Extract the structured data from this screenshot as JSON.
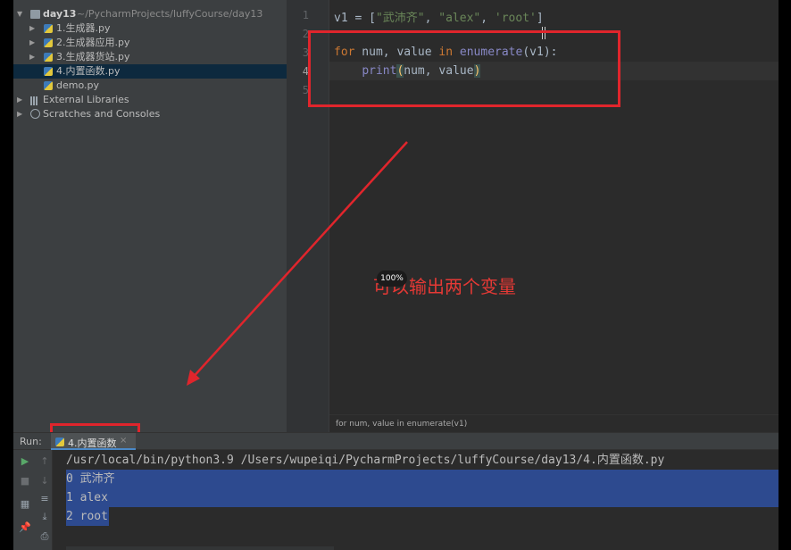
{
  "project": {
    "root": {
      "name": "day13",
      "path": "~/PycharmProjects/luffyCourse/day13"
    },
    "files": [
      {
        "label": "1.生成器.py",
        "selected": false
      },
      {
        "label": "2.生成器应用.py",
        "selected": false
      },
      {
        "label": "3.生成器货站.py",
        "selected": false
      },
      {
        "label": "4.内置函数.py",
        "selected": true
      },
      {
        "label": "demo.py",
        "selected": false
      }
    ],
    "external_libraries": "External Libraries",
    "scratches": "Scratches and Consoles"
  },
  "editor": {
    "line_numbers": [
      "1",
      "2",
      "3",
      "4",
      "5"
    ],
    "current_line": "4",
    "line1": {
      "var": "v1",
      "op": " = [",
      "s1": "\"武沛齐\"",
      "c1": ", ",
      "s2": "\"alex\"",
      "c2": ", ",
      "s3": "'root'",
      "end": "]"
    },
    "line3": {
      "kw_for": "for",
      "mid1": " num, value ",
      "kw_in": "in",
      "sp": " ",
      "fn": "enumerate",
      "args": "(v1):"
    },
    "line4": {
      "indent": "    ",
      "fn": "print",
      "lp": "(",
      "a1": "num, value",
      "rp": ")"
    },
    "breadcrumb": "for num, value in enumerate(v1)"
  },
  "annotation": {
    "text": "可以输出两个变量",
    "zoom_badge": "100%",
    "color": "#e0252c"
  },
  "run": {
    "label": "Run:",
    "tab": "4.内置函数",
    "close": "×",
    "command": "/usr/local/bin/python3.9 /Users/wupeiqi/PycharmProjects/luffyCourse/day13/4.内置函数.py",
    "output": [
      "0 武沛齐",
      "1 alex",
      "2 root"
    ]
  },
  "icons": {
    "play": "play-icon",
    "up": "arrow-up-icon",
    "down": "arrow-down-icon",
    "wrap": "soft-wrap-icon",
    "scroll": "scroll-to-end-icon",
    "pin": "pin-icon",
    "print": "print-icon"
  }
}
